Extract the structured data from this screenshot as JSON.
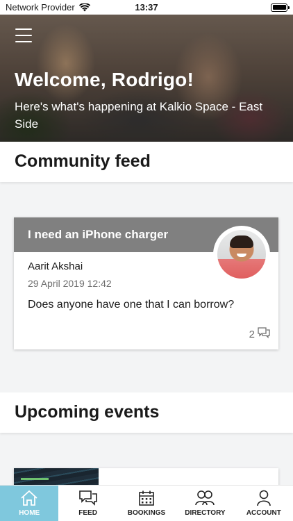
{
  "status_bar": {
    "carrier": "Network Provider",
    "time": "13:37"
  },
  "hero": {
    "title": "Welcome, Rodrigo!",
    "subtitle": "Here's what's happening at Kalkio Space - East Side"
  },
  "feed_section": {
    "title": "Community feed"
  },
  "post": {
    "title": "I need an iPhone charger",
    "author": "Aarit Akshai",
    "date": "29 April 2019 12:42",
    "message": "Does anyone have one that I can borrow?",
    "comment_count": "2"
  },
  "events_section": {
    "title": "Upcoming events"
  },
  "tabs": [
    {
      "label": "HOME",
      "icon": "home-icon",
      "active": true
    },
    {
      "label": "FEED",
      "icon": "chat-bubbles-icon",
      "active": false
    },
    {
      "label": "BOOKINGS",
      "icon": "calendar-icon",
      "active": false
    },
    {
      "label": "DIRECTORY",
      "icon": "people-icon",
      "active": false
    },
    {
      "label": "ACCOUNT",
      "icon": "person-icon",
      "active": false
    }
  ],
  "colors": {
    "active_tab": "#7fc8dd",
    "post_header": "#808080"
  }
}
